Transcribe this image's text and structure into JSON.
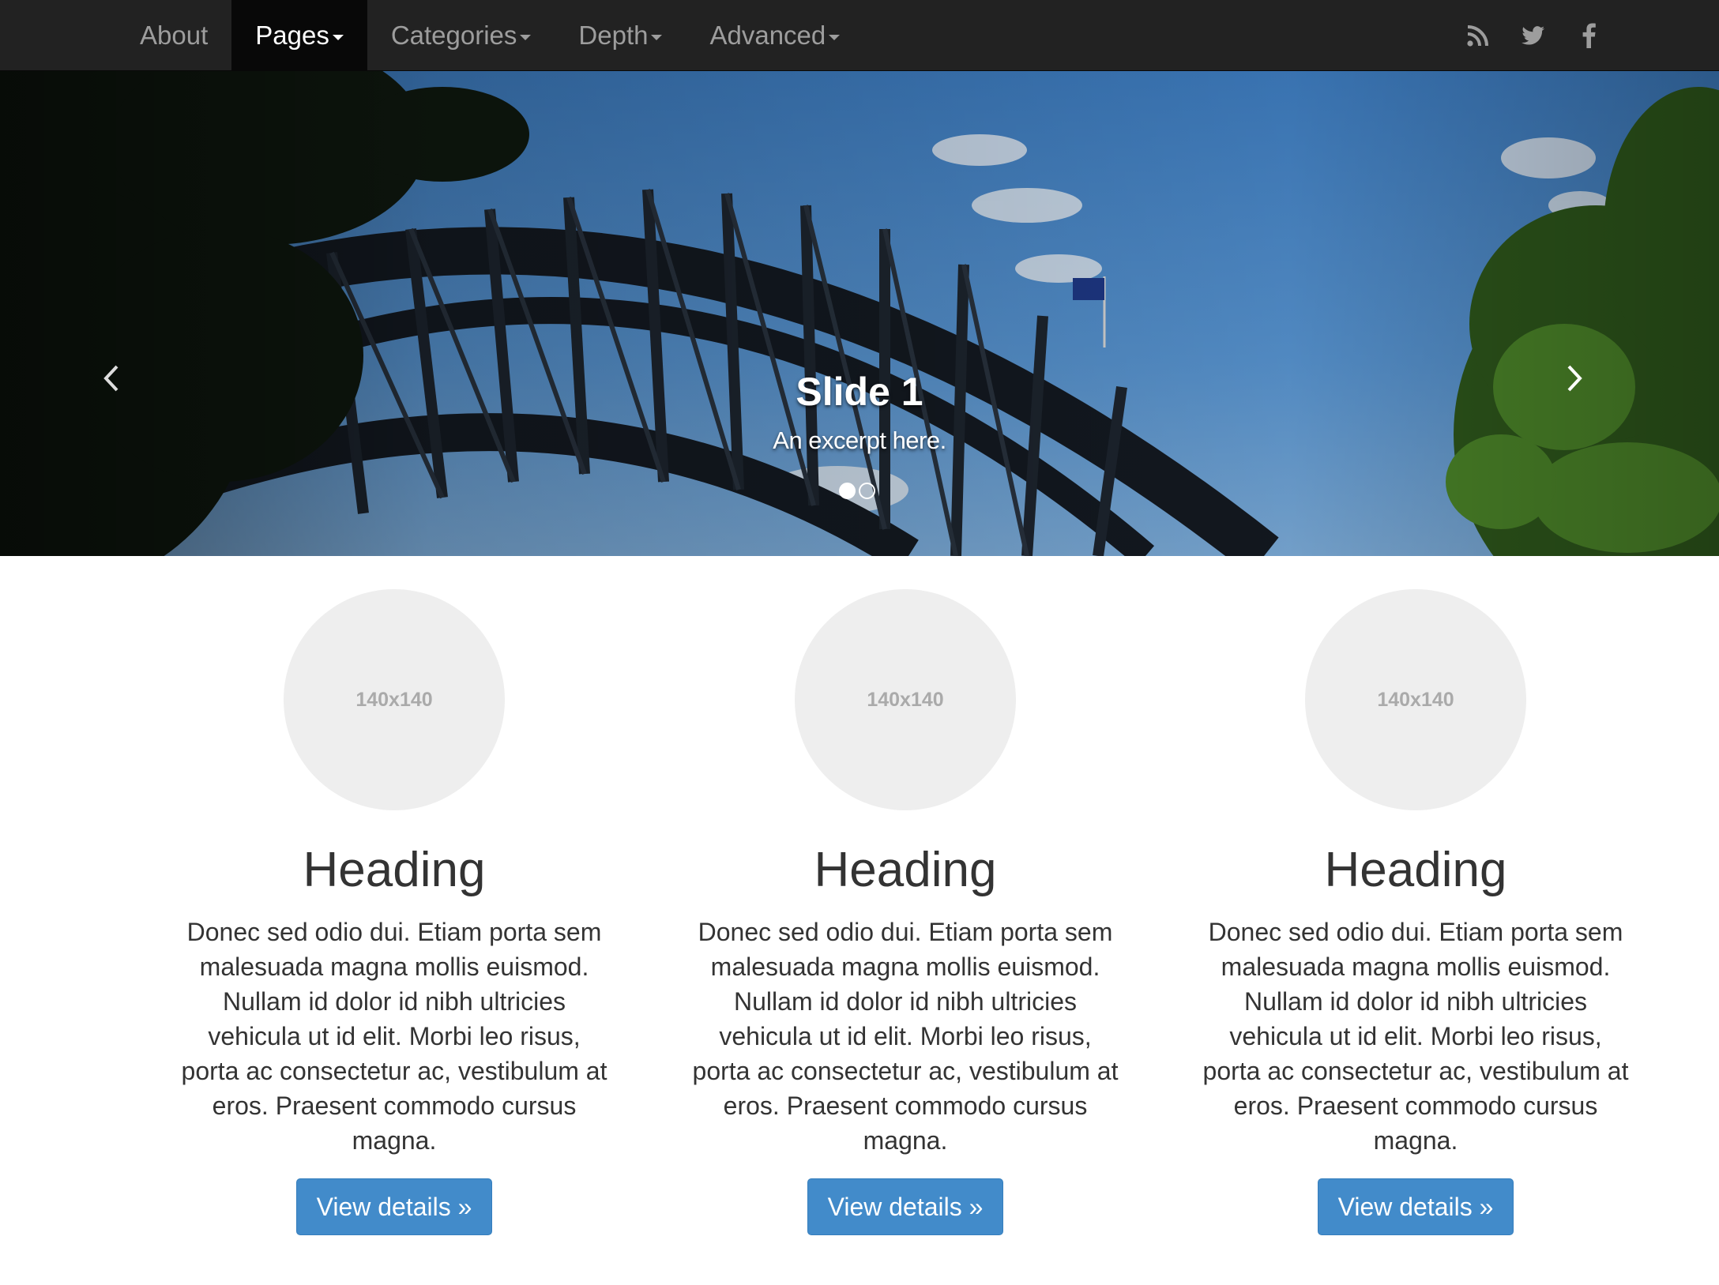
{
  "navbar": {
    "items": [
      {
        "label": "About",
        "dropdown": false
      },
      {
        "label": "Pages",
        "dropdown": true,
        "active": true
      },
      {
        "label": "Categories",
        "dropdown": true
      },
      {
        "label": "Depth",
        "dropdown": true
      },
      {
        "label": "Advanced",
        "dropdown": true
      }
    ],
    "social_icons": [
      "rss-icon",
      "twitter-icon",
      "facebook-icon"
    ],
    "colors": {
      "background": "#222222",
      "active": "#080808",
      "text": "#9d9d9d"
    }
  },
  "carousel": {
    "title": "Slide 1",
    "excerpt": "An excerpt here.",
    "indicator_count": 2,
    "active_index": 0,
    "controls": [
      "chevron-left-icon",
      "chevron-right-icon"
    ]
  },
  "marketing": {
    "columns": [
      {
        "image_label": "140x140",
        "heading": "Heading",
        "body": "Donec sed odio dui. Etiam porta sem malesuada magna mollis euismod. Nullam id dolor id nibh ultricies vehicula ut id elit. Morbi leo risus, porta ac consectetur ac, vestibulum at eros. Praesent commodo cursus magna.",
        "button": "View details »"
      },
      {
        "image_label": "140x140",
        "heading": "Heading",
        "body": "Donec sed odio dui. Etiam porta sem malesuada magna mollis euismod. Nullam id dolor id nibh ultricies vehicula ut id elit. Morbi leo risus, porta ac consectetur ac, vestibulum at eros. Praesent commodo cursus magna.",
        "button": "View details »"
      },
      {
        "image_label": "140x140",
        "heading": "Heading",
        "body": "Donec sed odio dui. Etiam porta sem malesuada magna mollis euismod. Nullam id dolor id nibh ultricies vehicula ut id elit. Morbi leo risus, porta ac consectetur ac, vestibulum at eros. Praesent commodo cursus magna.",
        "button": "View details »"
      }
    ],
    "colors": {
      "button": "#428bca",
      "placeholder": "#eeeeee",
      "text": "#333333"
    }
  }
}
